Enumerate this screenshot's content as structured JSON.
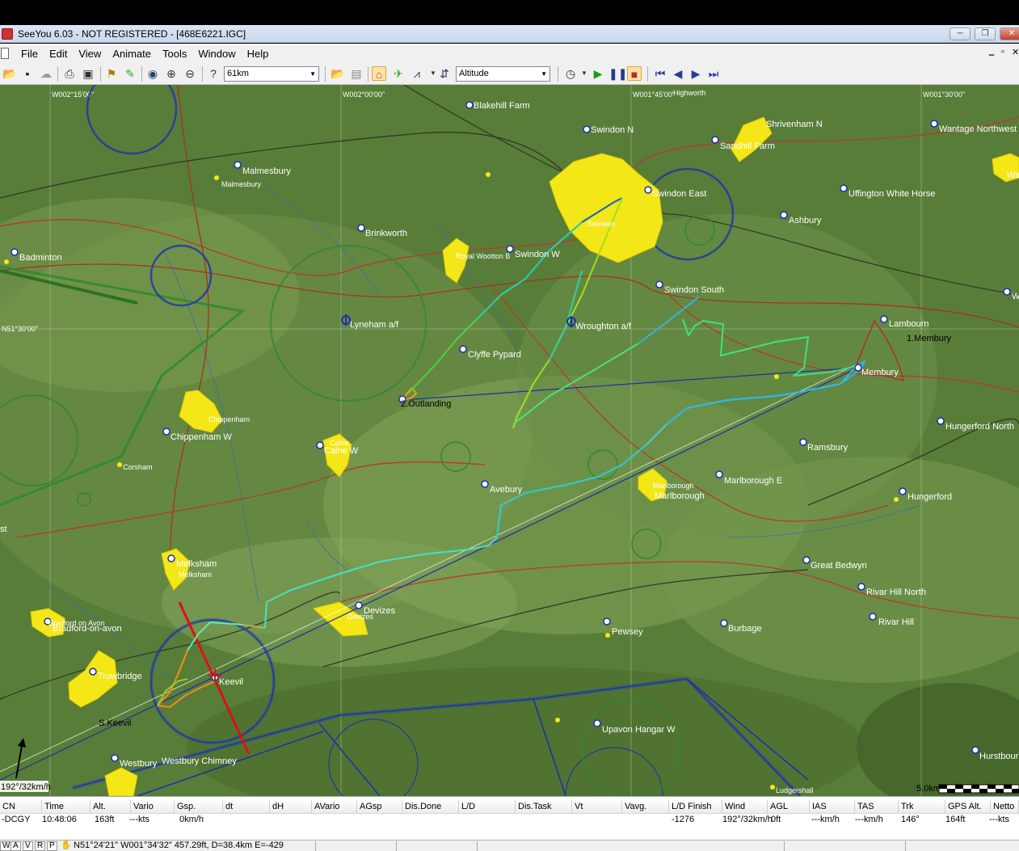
{
  "window": {
    "title": "SeeYou 6.03 - NOT REGISTERED - [468E6221.IGC]",
    "minimize_label": "─",
    "restore_label": "❐",
    "close_label": "✕"
  },
  "menu": {
    "items": [
      "File",
      "Edit",
      "View",
      "Animate",
      "Tools",
      "Window",
      "Help"
    ],
    "mdi_minimize": "‗",
    "mdi_restore": "▫",
    "mdi_close": "✕"
  },
  "toolbar": {
    "zoom_value": "61km",
    "display_value": "Altitude"
  },
  "map": {
    "grid_labels": {
      "w1": "W002°15'00\"",
      "w2": "W002°00'00\"",
      "w3": "W001°45'00\"",
      "w4": "W001°30'00\"",
      "n1": "N51°30'00\""
    },
    "places": {
      "blakehill": "Blakehill Farm",
      "swindon_n": "Swindon N",
      "shrivenham": "Shrivenham N",
      "sandhill": "Sandhill Farm",
      "wantage": "Wantage Northwest",
      "malmesbury": "Malmesbury",
      "malmesbury_town": "Malmesbury",
      "swindon_east": "Swindon East",
      "uffington": "Uffington White Horse",
      "ashbury": "Ashbury",
      "brinkworth": "Brinkworth",
      "badminton": "Badminton",
      "royal_wootton": "Royal Wootton B",
      "swindon_w": "Swindon W",
      "swindon_south": "Swindon South",
      "lyneham": "Lyneham a/f",
      "wroughton": "Wroughton a/f",
      "lambourn": "Lambourn",
      "membury_task": "1.Membury",
      "clyffe": "Clyffe Pypard",
      "membury": "Membury",
      "outlanding": "2.Outlanding",
      "hungerford_n": "Hungerford North",
      "chippenham_town": "Chippenham",
      "chippenham_w": "Chippenham W",
      "calne_w": "Calne W",
      "calne_town": "Calne",
      "ramsbury": "Ramsbury",
      "corsham": "Corsham",
      "avebury": "Avebury",
      "marlborough_e": "Marlborough E",
      "marlborough": "Marlborough",
      "marlborough_town": "Marlborough",
      "hungerford": "Hungerford",
      "melksham": "Melksham",
      "melksham_town": "Melksham",
      "great_bedwyn": "Great Bedwyn",
      "rivar_hill_n": "Rivar Hill North",
      "rivar_hill": "Rivar Hill",
      "devizes": "Devizes",
      "devizes_town": "Devizes",
      "bradford": "Bradford-on-avon",
      "bradford_town": "Bradford on Avon",
      "pewsey": "Pewsey",
      "burbage": "Burbage",
      "trowbridge": "Trowbridge",
      "keevil": "Keevil",
      "s_keevil": "S.Keevil",
      "upavon": "Upavon Hangar W",
      "westbury": "Westbury",
      "westbury_chimney": "Westbury Chimney",
      "hurstbourne": "Hurstbourne",
      "ludgershall": "Ludgershall",
      "highworth": "Highworth",
      "st_edge": "st",
      "w_edge1": "Wa",
      "w_edge2": "W",
      "swindon_town": "Swindon"
    },
    "wind_readout": "192°/32km/h",
    "scale_label": "5.0km"
  },
  "panel": {
    "headers": [
      "CN",
      "Time",
      "Alt.",
      "Vario",
      "Gsp.",
      "dt",
      "dH",
      "AVario",
      "AGsp",
      "Dis.Done",
      "L/D",
      "Dis.Task",
      "Vt",
      "Vavg.",
      "L/D Finish",
      "Wind",
      "AGL",
      "IAS",
      "TAS",
      "Trk",
      "GPS Alt.",
      "Netto"
    ],
    "values": {
      "cn": "-DCGY",
      "time": "10:48:06",
      "alt": "163ft",
      "vario": "---kts",
      "gsp": "0km/h",
      "ld_finish": "-1276",
      "wind": "192°/32km/h",
      "agl": "0ft",
      "ias": "---km/h",
      "tas": "---km/h",
      "trk": "146°",
      "gps_alt": "164ft",
      "netto": "---kts"
    }
  },
  "status": {
    "tabs": [
      "W",
      "A",
      "V",
      "R",
      "P"
    ],
    "text": "N51°24'21\" W001°34'32\" 457.29ft, D=38.4km E=-429"
  }
}
